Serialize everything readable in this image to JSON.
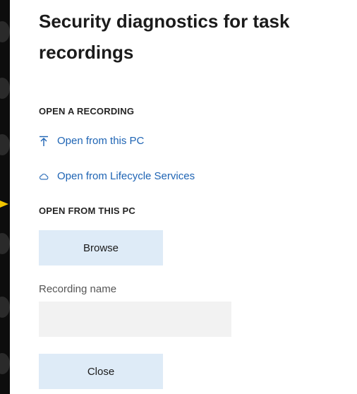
{
  "dialog": {
    "title": "Security diagnostics for task recordings",
    "open_section_label": "OPEN A RECORDING",
    "links": [
      {
        "label": "Open from this PC",
        "icon": "upload-icon"
      },
      {
        "label": "Open from Lifecycle Services",
        "icon": "cloud-icon"
      }
    ],
    "open_pc_section_label": "OPEN FROM THIS PC",
    "browse_label": "Browse",
    "recording_name_label": "Recording name",
    "recording_name_value": "",
    "close_label": "Close"
  },
  "colors": {
    "link": "#1e64b4",
    "button_bg": "#deebf7",
    "input_bg": "#f2f2f2",
    "pointer": "#f2c500"
  }
}
